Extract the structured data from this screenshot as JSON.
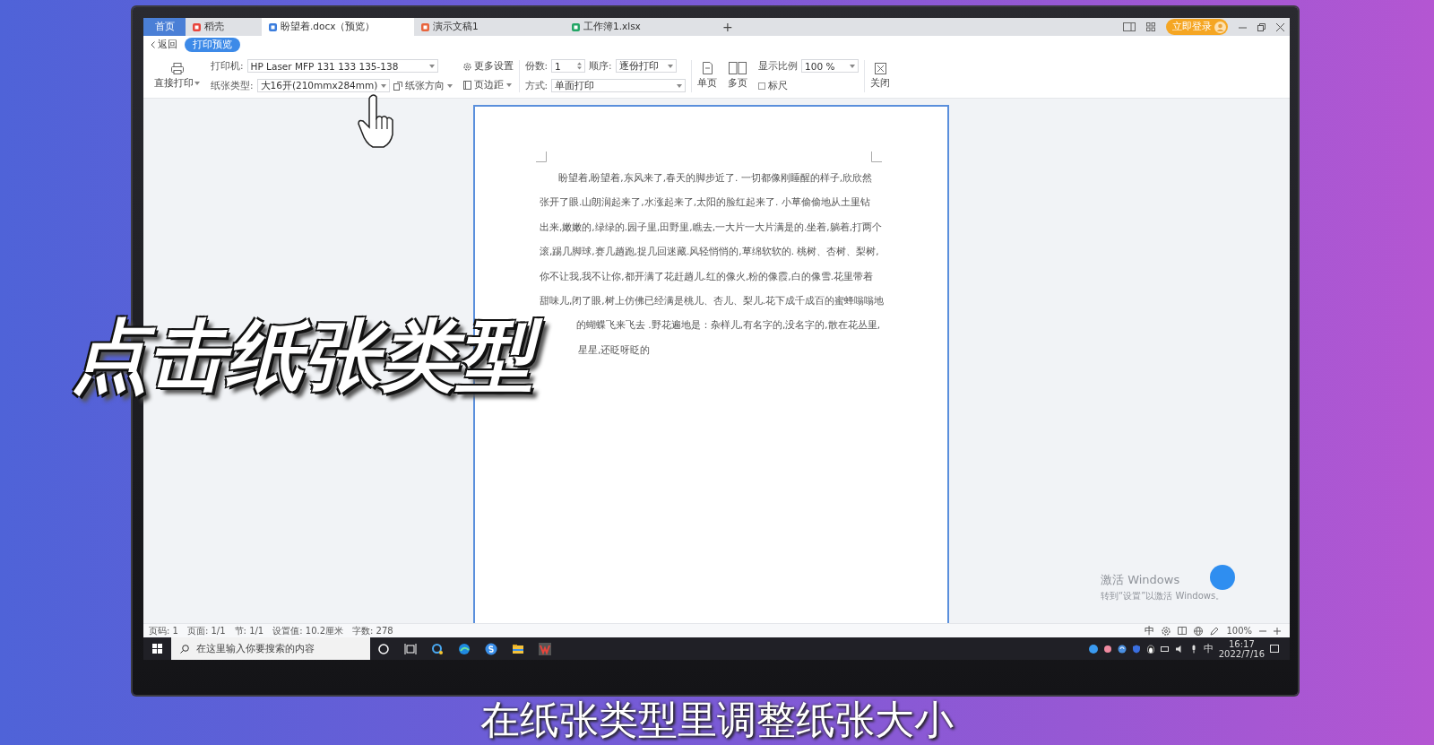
{
  "app_tabs": [
    {
      "label": "首页",
      "kind": "home",
      "selected": false
    },
    {
      "label": "稻壳",
      "kind": "docer",
      "selected": false
    },
    {
      "label": "盼望着.docx（预览）",
      "kind": "writer",
      "selected": true
    },
    {
      "label": "演示文稿1",
      "kind": "slides",
      "selected": false
    },
    {
      "label": "工作簿1.xlsx",
      "kind": "sheet",
      "selected": false
    }
  ],
  "new_tab": "+",
  "login_button": "立即登录",
  "nav": {
    "back": "返回",
    "mode_badge": "打印预览"
  },
  "toolbar": {
    "direct_print": "直接打印",
    "printer_label": "打印机:",
    "printer_value": "HP Laser MFP 131 133 135-138",
    "paper_label": "纸张类型:",
    "paper_value": "大16开(210mmx284mm)",
    "orientation": "纸张方向",
    "more_settings": "更多设置",
    "margins": "页边距",
    "copies_label": "份数:",
    "copies_value": "1",
    "order_label": "顺序:",
    "order_value": "逐份打印",
    "mode_label": "方式:",
    "mode_value": "单面打印",
    "single_page": "单页",
    "multi_page": "多页",
    "zoom_label": "显示比例",
    "zoom_value": "100 %",
    "ruler": {
      "label": "标尺",
      "checked": false
    },
    "close": "关闭"
  },
  "document": {
    "lines": [
      {
        "kind": "first",
        "text": "盼望着,盼望着,东风来了,春天的脚步近了. 一切都像刚睡醒的样子,欣欣然"
      },
      {
        "kind": "plain",
        "text": "张开了眼.山朗润起来了,水涨起来了,太阳的脸红起来了. 小草偷偷地从土里钻"
      },
      {
        "kind": "plain",
        "text": "出来,嫩嫩的,绿绿的.园子里,田野里,瞧去,一大片一大片满是的.坐着,躺着,打两个"
      },
      {
        "kind": "plain",
        "text": "滚,踢几脚球,赛几趟跑,捉几回迷藏.风轻悄悄的,草绵软软的. 桃树、杏树、梨树,"
      },
      {
        "kind": "plain",
        "text": "你不让我,我不让你,都开满了花赶趟儿.红的像火,粉的像霞,白的像雪.花里带着"
      },
      {
        "kind": "plain",
        "text": "甜味儿,闭了眼,树上仿佛已经满是桃儿、杏儿、梨儿.花下成千成百的蜜蜂嗡嗡地"
      },
      {
        "kind": "covered",
        "text": "的蝴蝶飞来飞去 .野花遍地是：杂样儿,有名字的,没名字的,散在花丛里,"
      },
      {
        "kind": "covered",
        "text": "星星,还眨呀眨的"
      }
    ]
  },
  "activation": {
    "title": "激活 Windows",
    "hint": "转到“设置”以激活 Windows。"
  },
  "status_bar": {
    "items": [
      "页码: 1",
      "页面: 1/1",
      "节: 1/1",
      "设置值: 10.2厘米",
      "字数: 278"
    ],
    "ime": "中",
    "zoom_value": "100%"
  },
  "taskbar": {
    "search_placeholder": "在这里输入你要搜索的内容",
    "ime": "中",
    "time": "16:17",
    "date": "2022/7/16"
  },
  "overlay_caption": "点击纸张类型",
  "subtitle": "在纸张类型里调整纸张大小"
}
